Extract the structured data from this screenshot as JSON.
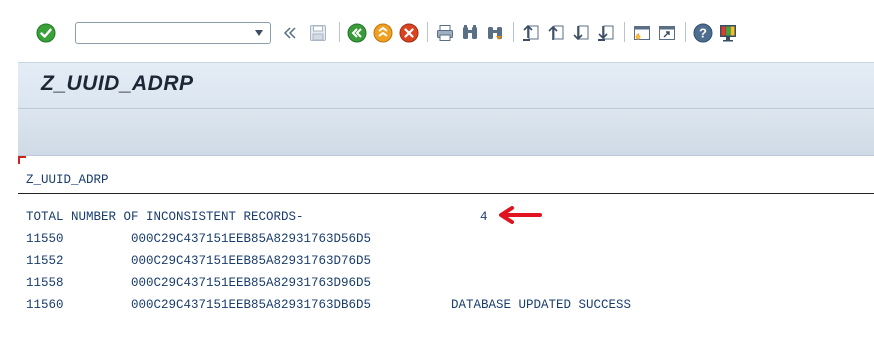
{
  "toolbar": {
    "command_field": {
      "value": "",
      "placeholder": ""
    },
    "icons": [
      "enter-icon",
      "command-dropdown-icon",
      "collapse-icon",
      "save-icon",
      "back-icon",
      "exit-icon",
      "cancel-icon",
      "print-icon",
      "find-icon",
      "find-next-icon",
      "first-page-icon",
      "previous-page-icon",
      "next-page-icon",
      "last-page-icon",
      "create-session-icon",
      "create-shortcut-icon",
      "help-icon",
      "customize-layout-icon"
    ],
    "colors": {
      "enter": "#2e9e2e",
      "back": "#3a9b3a",
      "exit": "#e28a12",
      "cancel": "#d23a1e",
      "neutral": "#5a6f86"
    }
  },
  "window": {
    "title": "Z_UUID_ADRP"
  },
  "report": {
    "header": "Z_UUID_ADRP",
    "total_label": "TOTAL NUMBER OF INCONSISTENT RECORDS-",
    "total_value": "4",
    "arrow_color": "#e0141e",
    "rows": [
      {
        "id": "11550",
        "uuid": "000C29C437151EEB85A82931763D56D5",
        "status": ""
      },
      {
        "id": "11552",
        "uuid": "000C29C437151EEB85A82931763D76D5",
        "status": ""
      },
      {
        "id": "11558",
        "uuid": "000C29C437151EEB85A82931763D96D5",
        "status": ""
      },
      {
        "id": "11560",
        "uuid": "000C29C437151EEB85A82931763DB6D5",
        "status": "DATABASE UPDATED SUCCESS"
      }
    ]
  }
}
